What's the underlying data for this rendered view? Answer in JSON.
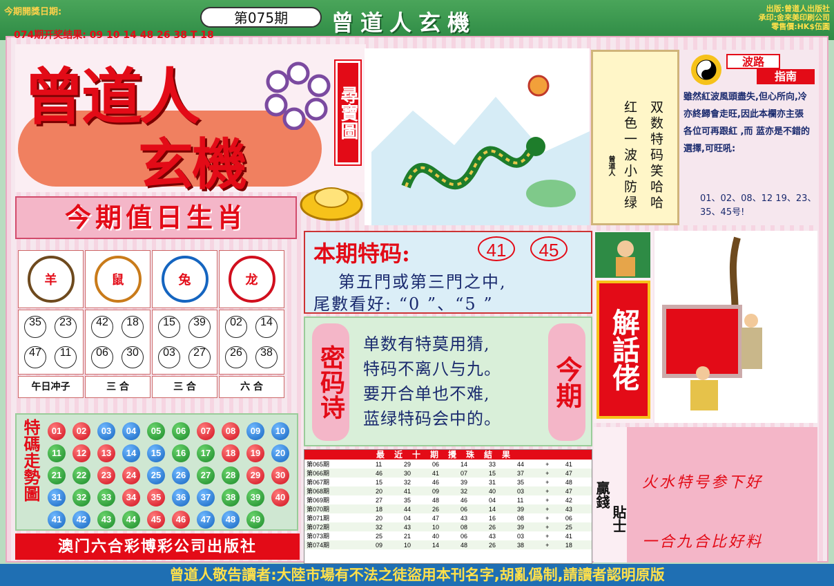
{
  "header": {
    "open_date_label": "今期開獎日期:",
    "issue": "第075期",
    "brand": "曾道人玄機",
    "prev_result": "074期开奖结果: 09 10 14 48 26 38 T 18",
    "publisher_lines": [
      "出版:曾道人出版社",
      "承印:金來美印刷公司",
      "零售價:HK$伍圓"
    ]
  },
  "logo": {
    "line1": "曾道人",
    "line2": "玄機",
    "side": "尋寶圖"
  },
  "zodiac": {
    "banner": "今期值日生肖",
    "animals": [
      {
        "name": "羊",
        "numbers": [
          "35",
          "23",
          "47",
          "11"
        ],
        "note": "午日冲子"
      },
      {
        "name": "鼠",
        "numbers": [
          "42",
          "18",
          "06",
          "30"
        ],
        "note": "三 合"
      },
      {
        "name": "兔",
        "numbers": [
          "15",
          "39",
          "03",
          "27"
        ],
        "note": "三 合"
      },
      {
        "name": "龙",
        "numbers": [
          "02",
          "14",
          "26",
          "38"
        ],
        "note": "六 合"
      }
    ]
  },
  "trend": {
    "title": "特碼走勢圖",
    "rows": [
      [
        "01",
        "02",
        "03",
        "04",
        "05",
        "06",
        "07",
        "08",
        "09",
        "10"
      ],
      [
        "11",
        "12",
        "13",
        "14",
        "15",
        "16",
        "17",
        "18",
        "19",
        "20"
      ],
      [
        "21",
        "22",
        "23",
        "24",
        "25",
        "26",
        "27",
        "28",
        "29",
        "30"
      ],
      [
        "31",
        "32",
        "33",
        "34",
        "35",
        "36",
        "37",
        "38",
        "39",
        "40"
      ],
      [
        "41",
        "42",
        "43",
        "44",
        "45",
        "46",
        "47",
        "48",
        "49"
      ]
    ],
    "colors": [
      [
        "r",
        "r",
        "b",
        "b",
        "g",
        "g",
        "r",
        "r",
        "b",
        "b"
      ],
      [
        "g",
        "r",
        "r",
        "b",
        "b",
        "g",
        "g",
        "r",
        "r",
        "b"
      ],
      [
        "g",
        "g",
        "r",
        "r",
        "b",
        "b",
        "g",
        "g",
        "r",
        "r"
      ],
      [
        "b",
        "g",
        "g",
        "r",
        "r",
        "b",
        "b",
        "g",
        "g",
        "r"
      ],
      [
        "b",
        "b",
        "g",
        "g",
        "r",
        "r",
        "b",
        "b",
        "g"
      ]
    ]
  },
  "publisher_bar": "澳门六合彩博彩公司出版社",
  "special": {
    "label": "本期特码:",
    "numbers": [
      "41",
      "45"
    ],
    "line1": "第五門或第三門之中,",
    "line2": "尾數看好: “0 ”、“5 ”"
  },
  "poem": {
    "left": "密码诗",
    "right": "今期",
    "lines": [
      "单数有特莫用猜,",
      "特码不离八与九。",
      "要开合单也不难,",
      "蓝绿特码会中的。"
    ]
  },
  "results": {
    "title": "最近十期攪珠結果",
    "rows": [
      [
        "第065期",
        "11",
        "29",
        "06",
        "14",
        "33",
        "44",
        "+",
        "41"
      ],
      [
        "第066期",
        "46",
        "30",
        "41",
        "07",
        "15",
        "37",
        "+",
        "47"
      ],
      [
        "第067期",
        "15",
        "32",
        "46",
        "39",
        "31",
        "35",
        "+",
        "48"
      ],
      [
        "第068期",
        "20",
        "41",
        "09",
        "32",
        "40",
        "03",
        "+",
        "47"
      ],
      [
        "第069期",
        "27",
        "35",
        "48",
        "46",
        "04",
        "11",
        "+",
        "42"
      ],
      [
        "第070期",
        "18",
        "44",
        "26",
        "06",
        "14",
        "39",
        "+",
        "43"
      ],
      [
        "第071期",
        "20",
        "04",
        "47",
        "43",
        "16",
        "08",
        "+",
        "06"
      ],
      [
        "第072期",
        "32",
        "43",
        "10",
        "08",
        "26",
        "39",
        "+",
        "25"
      ],
      [
        "第073期",
        "25",
        "21",
        "40",
        "06",
        "43",
        "03",
        "+",
        "41"
      ],
      [
        "第074期",
        "09",
        "10",
        "14",
        "48",
        "26",
        "38",
        "+",
        "18"
      ]
    ]
  },
  "scroll": {
    "col1": "双数特码笑哈哈",
    "col2": "红色一波小防绿",
    "sig": "曾道人"
  },
  "wave": {
    "title1": "波路",
    "title2": "指南",
    "text": "雖然紅波風頭盡失,但心所向,冷亦終歸會走旺,因此本欄亦主張各位可再跟紅 ,而 蓝亦是不錯的選擇,可旺吼:",
    "nums": "01、02、08、12  19、23、35、45号!"
  },
  "jiehua": {
    "label": "解話佬"
  },
  "tips": {
    "side1": "贏錢",
    "side2": "貼士",
    "line1": "火水特号参下好",
    "line2": "一合九合比好料"
  },
  "footer": "曾道人敬告讀者:大陸市場有不法之徒盜用本刊名字,胡亂僞制,請讀者認明原版"
}
